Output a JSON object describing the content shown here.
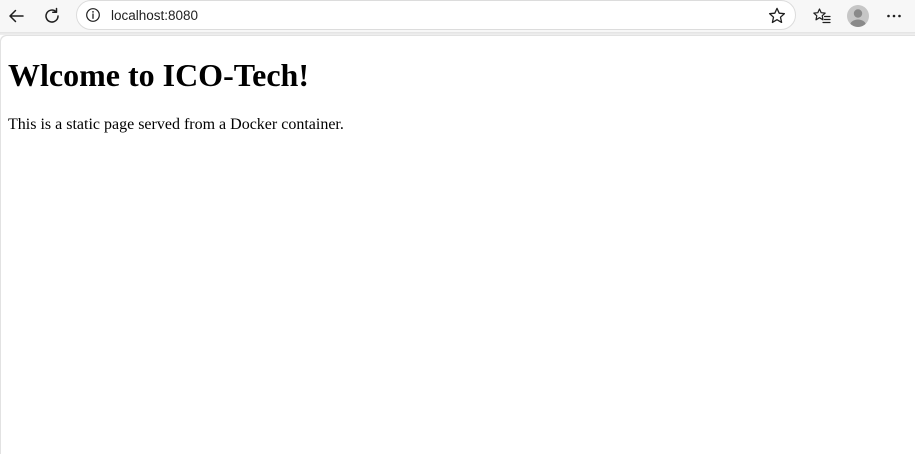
{
  "browser": {
    "address": "localhost:8080",
    "icons": {
      "back": "arrow-left-icon",
      "reload": "reload-icon",
      "site_info": "info-circle-icon",
      "favorite": "star-outline-icon",
      "favorites_list": "favorites-star-list-icon",
      "profile": "user-avatar-icon",
      "more": "ellipsis-horizontal-icon"
    },
    "colors": {
      "chrome_background": "#f7f7f7",
      "icon": "#1f1f1f",
      "avatar_background": "#c6c6c6",
      "avatar_figure": "#8a8a8a"
    }
  },
  "page": {
    "heading": "Wlcome to ICO-Tech!",
    "paragraph": "This is a static page served from a Docker container."
  }
}
